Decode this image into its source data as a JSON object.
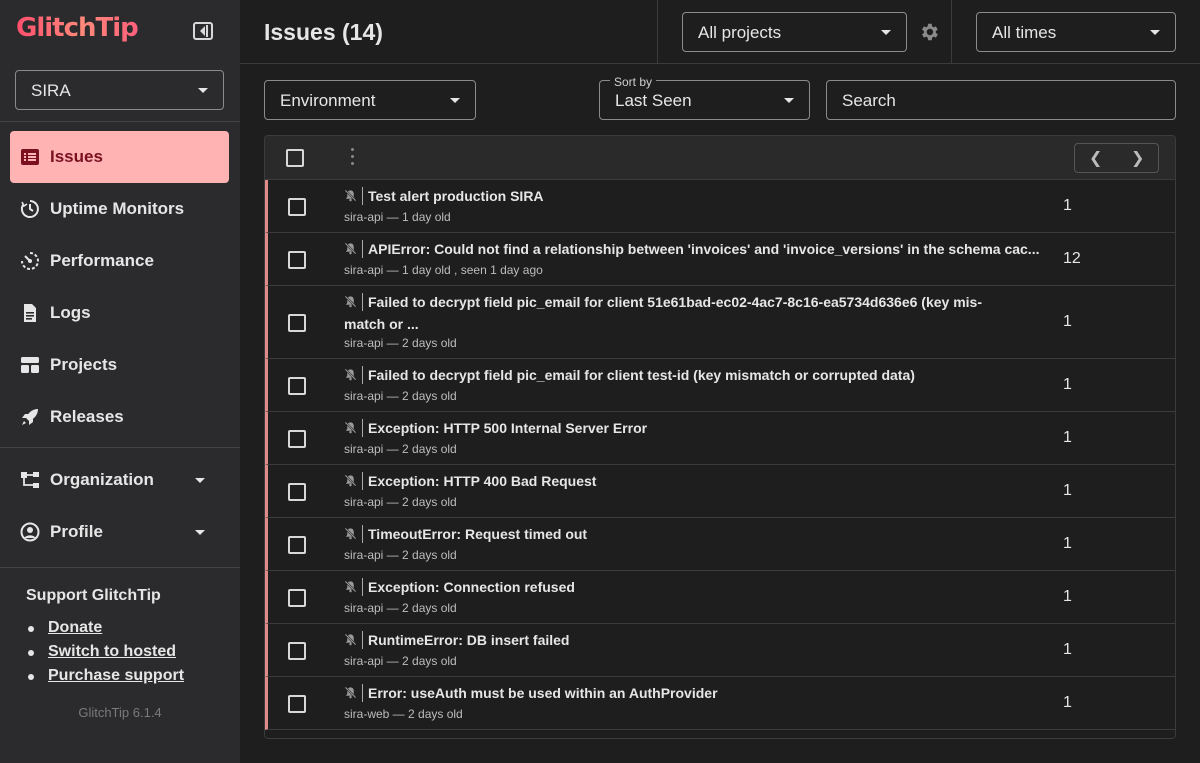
{
  "app": {
    "logo": "GlitchTip",
    "version": "GlitchTip 6.1.4"
  },
  "org_select": {
    "value": "SIRA"
  },
  "nav": {
    "items": [
      {
        "label": "Issues",
        "icon": "issues-list-icon"
      },
      {
        "label": "Uptime Monitors",
        "icon": "uptime-clock-icon"
      },
      {
        "label": "Performance",
        "icon": "performance-gauge-icon"
      },
      {
        "label": "Logs",
        "icon": "document-icon"
      },
      {
        "label": "Projects",
        "icon": "projects-grid-icon"
      },
      {
        "label": "Releases",
        "icon": "rocket-icon"
      }
    ],
    "organization": "Organization",
    "profile": "Profile"
  },
  "support": {
    "title": "Support GlitchTip",
    "links": [
      "Donate",
      "Switch to hosted",
      "Purchase support"
    ]
  },
  "header": {
    "title": "Issues (14)",
    "projects": "All projects",
    "times": "All times"
  },
  "filters": {
    "environment": "Environment",
    "sort_label": "Sort by",
    "sort_value": "Last Seen",
    "search_placeholder": "Search"
  },
  "colors": {
    "accent": "#ffb3b3",
    "row_marker": "#e08a8a",
    "logo": "#ff5f7a"
  },
  "issues": [
    {
      "title": "Test alert production SIRA",
      "title2": "",
      "meta": "sira-api — 1 day old",
      "count": "1"
    },
    {
      "title": "APIError: Could not find a relationship between 'invoices' and 'invoice_versions' in the schema cac...",
      "title2": "",
      "meta": "sira-api — 1 day old , seen 1 day ago",
      "count": "12"
    },
    {
      "title": "Failed to decrypt field pic_email for client 51e61bad-ec02-4ac7-8c16-ea5734d636e6 (key mis-",
      "title2": "match or ...",
      "meta": "sira-api — 2 days old",
      "count": "1"
    },
    {
      "title": "Failed to decrypt field pic_email for client test-id (key mismatch or corrupted data)",
      "title2": "",
      "meta": "sira-api — 2 days old",
      "count": "1"
    },
    {
      "title": "Exception: HTTP 500 Internal Server Error",
      "title2": "",
      "meta": "sira-api — 2 days old",
      "count": "1"
    },
    {
      "title": "Exception: HTTP 400 Bad Request",
      "title2": "",
      "meta": "sira-api — 2 days old",
      "count": "1"
    },
    {
      "title": "TimeoutError: Request timed out",
      "title2": "",
      "meta": "sira-api — 2 days old",
      "count": "1"
    },
    {
      "title": "Exception: Connection refused",
      "title2": "",
      "meta": "sira-api — 2 days old",
      "count": "1"
    },
    {
      "title": "RuntimeError: DB insert failed",
      "title2": "",
      "meta": "sira-api — 2 days old",
      "count": "1"
    },
    {
      "title": "Error: useAuth must be used within an AuthProvider",
      "title2": "",
      "meta": "sira-web — 2 days old",
      "count": "1"
    }
  ]
}
